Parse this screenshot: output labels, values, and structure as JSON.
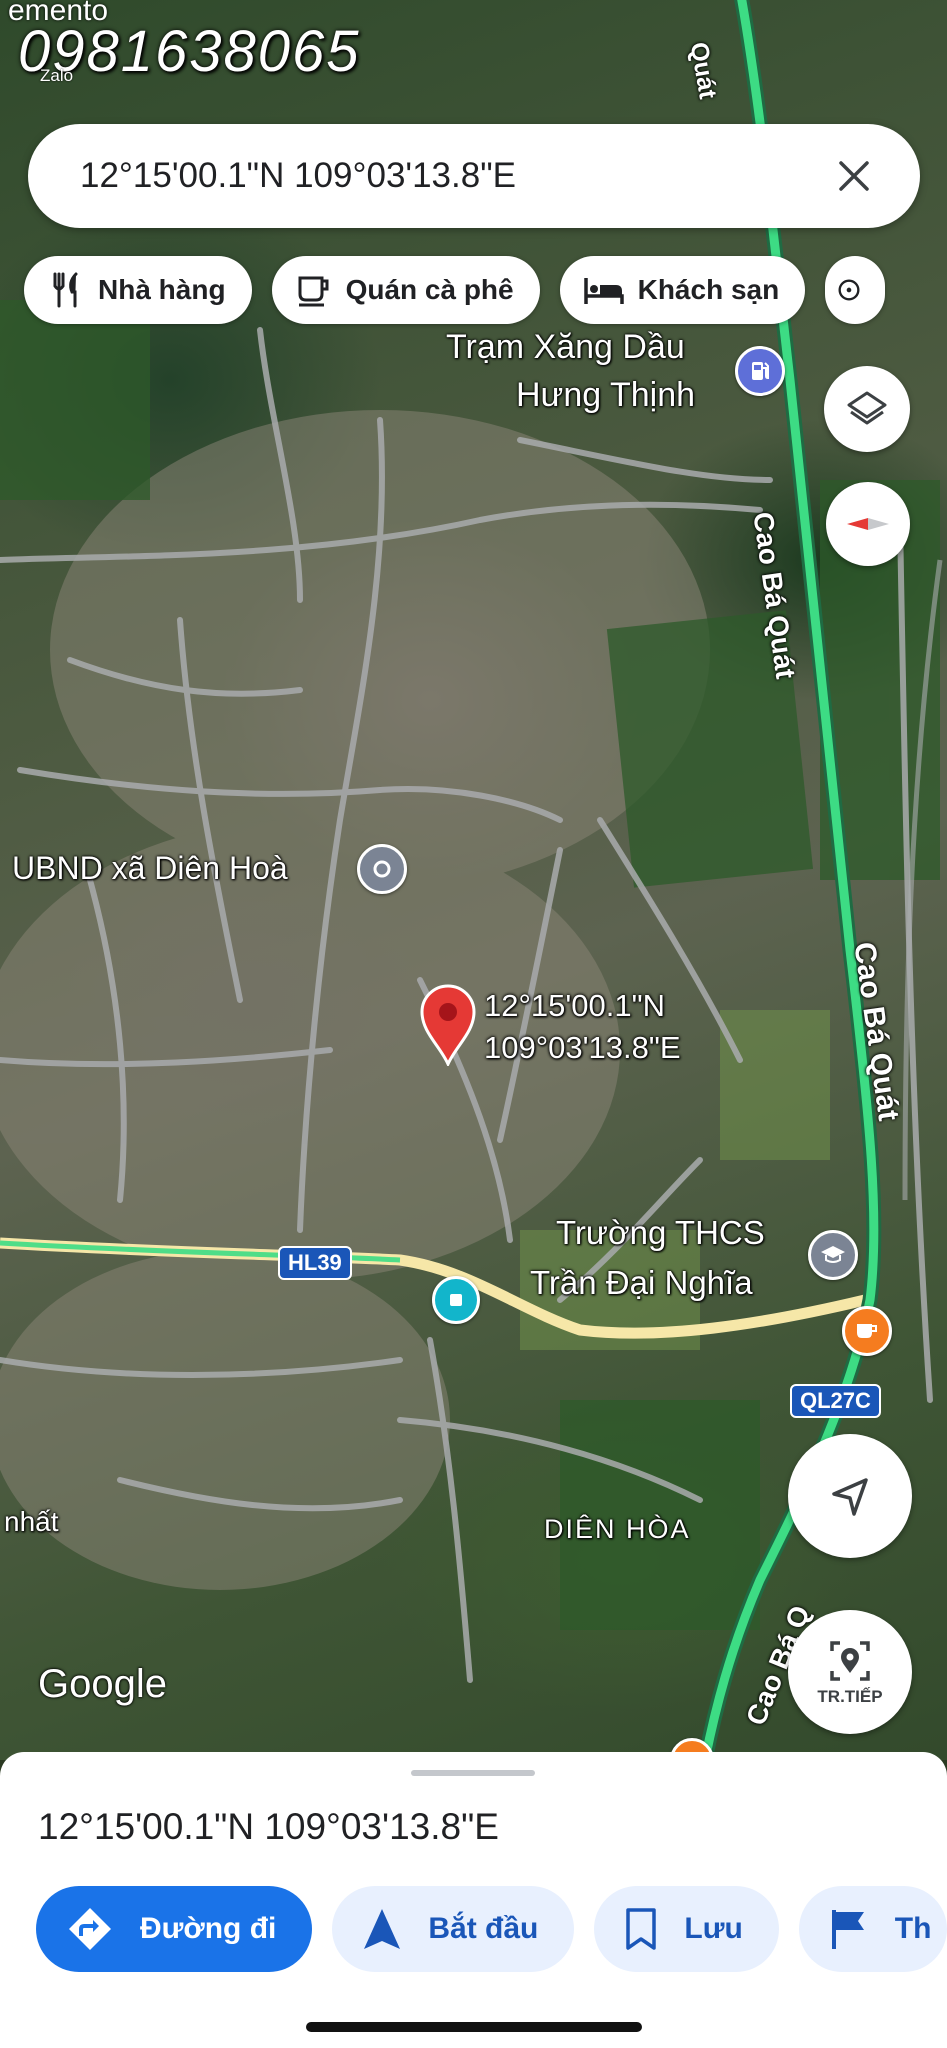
{
  "watermark": {
    "phone": "0981638065",
    "app_hint": "Zalo",
    "clipped_text": "emento"
  },
  "search": {
    "query": "12°15'00.1\"N 109°03'13.8\"E"
  },
  "chips": [
    {
      "label": "Nhà hàng",
      "icon": "fork-knife-icon"
    },
    {
      "label": "Quán cà phê",
      "icon": "coffee-cup-icon"
    },
    {
      "label": "Khách sạn",
      "icon": "bed-icon"
    }
  ],
  "map": {
    "labels": {
      "gas_station_line1": "Trạm Xăng Dầu",
      "gas_station_line2": "Hưng Thịnh",
      "commune_office": "UBND xã Diên Hoà",
      "school_line1": "Trường THCS",
      "school_line2": "Trần Đại Nghĩa",
      "area": "DIÊN HÒA",
      "partial_left": "nhất"
    },
    "roads": {
      "cao_ba_quat_1": "Cao Bá Quát",
      "cao_ba_quat_2": "Cao Bá Quát",
      "cao_ba_quat_3": "Cao Bá Q",
      "top_clipped": "Quát",
      "shield_hl39": "HL39",
      "shield_ql27c": "QL27C"
    },
    "pin": {
      "line1": "12°15'00.1\"N",
      "line2": "109°03'13.8\"E",
      "color": "#e53935"
    },
    "controls": {
      "live_view_label": "TR.TIẾP"
    },
    "attribution": "Google",
    "colors": {
      "highway": "#3ddc84",
      "local_road": "#f6e7a8"
    }
  },
  "sheet": {
    "title": "12°15'00.1\"N 109°03'13.8\"E",
    "actions": [
      {
        "label": "Đường đi",
        "icon": "directions-icon",
        "primary": true
      },
      {
        "label": "Bắt đầu",
        "icon": "navigation-arrow-icon",
        "primary": false
      },
      {
        "label": "Lưu",
        "icon": "bookmark-icon",
        "primary": false
      },
      {
        "label": "Th",
        "icon": "flag-icon",
        "primary": false
      }
    ],
    "accent": "#1a73e8"
  }
}
